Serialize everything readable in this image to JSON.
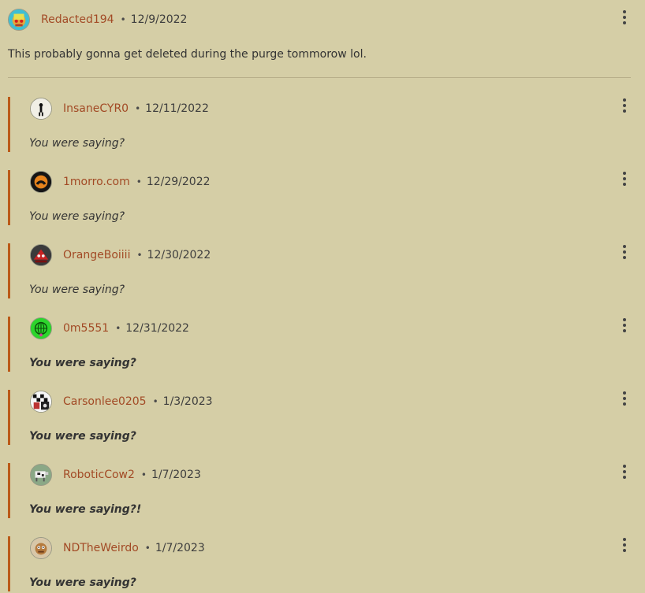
{
  "parent": {
    "username": "Redacted194",
    "date": "12/9/2022",
    "text": "This probably gonna get deleted during the purge tommorow lol."
  },
  "replies": [
    {
      "username": "InsaneCYR0",
      "date": "12/11/2022",
      "text": "You were saying?",
      "bold": false,
      "avatar": "stick-figure-avatar"
    },
    {
      "username": "1morro.com",
      "date": "12/29/2022",
      "text": "You were saying?",
      "bold": false,
      "avatar": "orange-logo-avatar"
    },
    {
      "username": "OrangeBoiiii",
      "date": "12/30/2022",
      "text": "You were saying?",
      "bold": false,
      "avatar": "red-dark-avatar"
    },
    {
      "username": "0m5551",
      "date": "12/31/2022",
      "text": "You were saying?",
      "bold": true,
      "avatar": "green-globe-avatar"
    },
    {
      "username": "Carsonlee0205",
      "date": "1/3/2023",
      "text": "You were saying?",
      "bold": true,
      "avatar": "checker-avatar"
    },
    {
      "username": "RoboticCow2",
      "date": "1/7/2023",
      "text": "You were saying?!",
      "bold": true,
      "avatar": "cow-avatar"
    },
    {
      "username": "NDTheWeirdo",
      "date": "1/7/2023",
      "text": "You were saying?",
      "bold": true,
      "avatar": "creature-avatar"
    }
  ],
  "separator": "•",
  "colors": {
    "background": "#d5cea6",
    "username": "#a24a25",
    "reply_bar": "#bb5a18",
    "divider": "#b7ae89"
  }
}
